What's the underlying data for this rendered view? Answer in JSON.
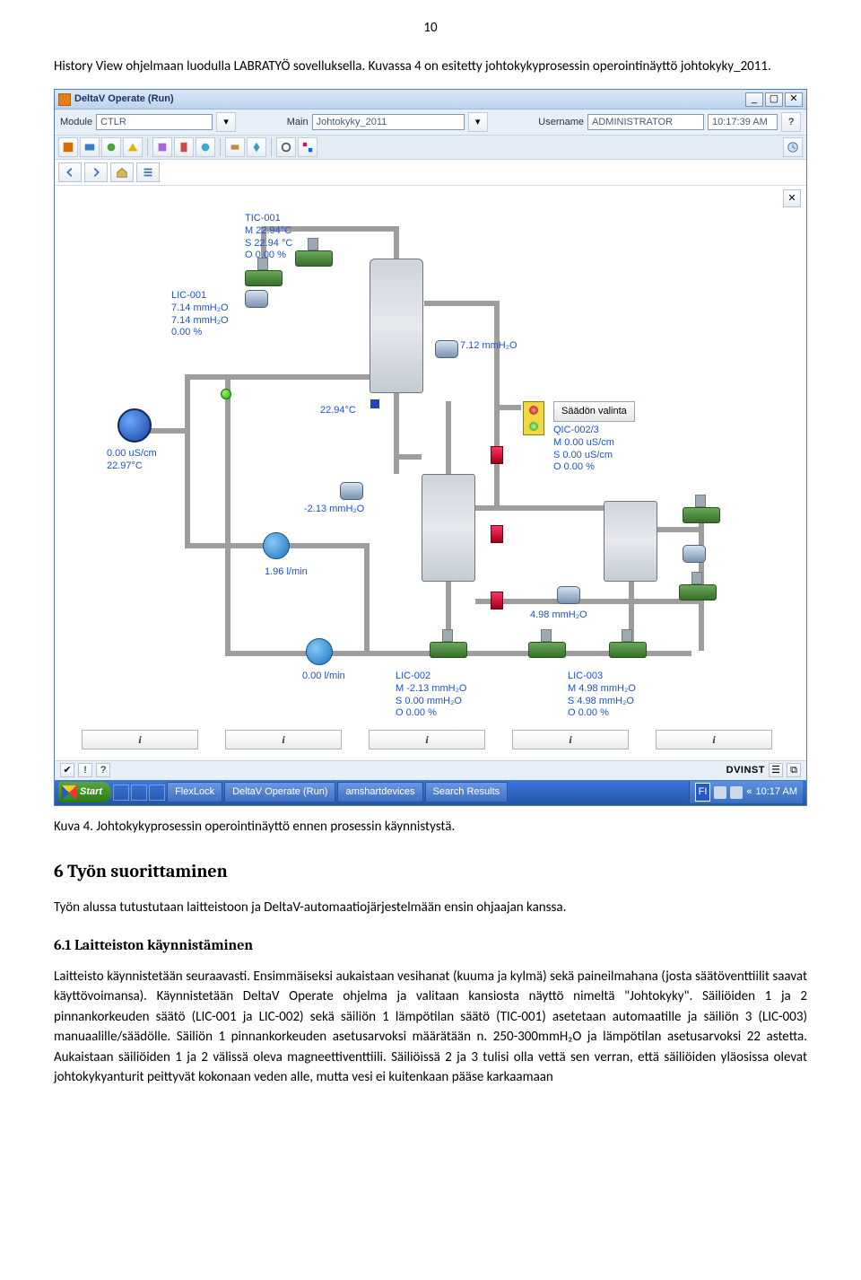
{
  "page_number": "10",
  "para_intro": "History View ohjelmaan luodulla LABRATYÖ sovelluksella. Kuvassa 4 on esitetty johtokykyprosessin operointinäyttö johtokyky_2011.",
  "app": {
    "title": "DeltaV Operate (Run)",
    "fields": {
      "module_label": "Module",
      "module_value": "CTLR",
      "main_label": "Main",
      "main_value": "Johtokyky_2011",
      "user_label": "Username",
      "user_value": "ADMINISTRATOR",
      "time": "10:17:39 AM"
    }
  },
  "hmi": {
    "tic001": {
      "name": "TIC-001",
      "m": "M  22.94°C",
      "s": "S   22.94 °C",
      "o": "O   0.00 %"
    },
    "lic001": {
      "name": "LIC-001",
      "l1": "7.14 mmH₂O",
      "l2": "7.14 mmH₂O",
      "l3": "0.00 %"
    },
    "tank1_right": "7.12 mmH₂O",
    "tank1_left": "22.94°C",
    "sensor_left": {
      "v": "0.00 uS/cm",
      "t": "22.97°C"
    },
    "mid_level": "-2.13 mmH₂O",
    "flow_bottom": "1.96 l/min",
    "flow_zero": "0.00 l/min",
    "tank3_level": "4.98 mmH₂O",
    "valve_sel_label": "Säädön valinta",
    "qic": {
      "name": "QIC-002/3",
      "m": "M   0.00 uS/cm",
      "s": "S   0.00 uS/cm",
      "o": "O   0.00 %"
    },
    "lic002": {
      "name": "LIC-002",
      "m": "M   -2.13 mmH₂O",
      "s": "S   0.00 mmH₂O",
      "o": "O   0.00 %"
    },
    "lic003": {
      "name": "LIC-003",
      "m": "M   4.98 mmH₂O",
      "s": "S   4.98 mmH₂O",
      "o": "O   0.00 %"
    },
    "bottom_info": "i",
    "station": "DVINST"
  },
  "taskbar": {
    "start": "Start",
    "tabs": [
      "FlexLock",
      "DeltaV Operate (Run)",
      "amshartdevices",
      "Search Results"
    ],
    "tray_time": "10:17 AM",
    "tray_lang": "FI"
  },
  "caption": "Kuva 4. Johtokykyprosessin operointinäyttö ennen prosessin käynnistystä.",
  "section6_title": "6   Työn suorittaminen",
  "section6_intro": "Työn alussa tutustutaan laitteistoon ja DeltaV-automaatiojärjestelmään ensin ohjaajan kanssa.",
  "section61_title": "6.1   Laitteiston käynnistäminen",
  "section61_body": "Laitteisto käynnistetään seuraavasti. Ensimmäiseksi aukaistaan vesihanat (kuuma ja kylmä) sekä paineilmahana (josta säätöventtiilit saavat käyttövoimansa). Käynnistetään DeltaV Operate ohjelma ja valitaan kansiosta näyttö nimeltä \"Johtokyky\". Säiliöiden 1 ja 2 pinnankorkeuden säätö (LIC-001 ja LIC-002) sekä säiliön 1 lämpötilan säätö (TIC-001) asetetaan automaatille ja säiliön 3 (LIC-003) manuaalille/säädölle. Säiliön 1 pinnankorkeuden asetusarvoksi määrätään n. 250-300mmH₂O ja lämpötilan asetusarvoksi 22 astetta. Aukaistaan säiliöiden 1 ja 2 välissä oleva magneettiventtiili. Säiliöissä 2 ja 3 tulisi olla vettä sen verran, että säiliöiden yläosissa olevat johtokykyanturit peittyvät kokonaan veden alle, mutta vesi ei kuitenkaan pääse karkaamaan"
}
